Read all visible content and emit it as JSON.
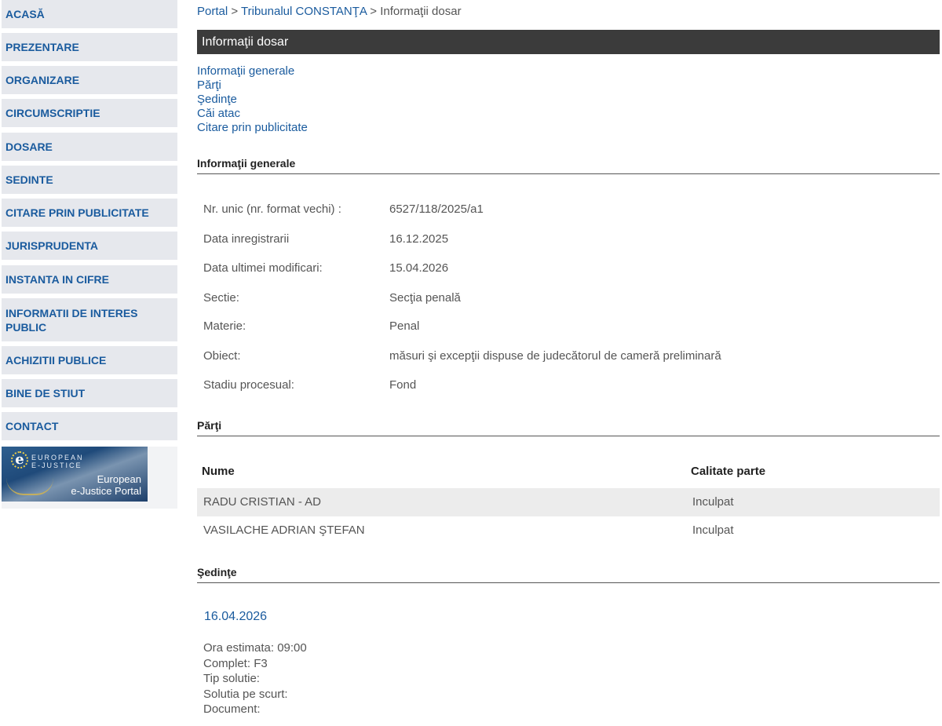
{
  "sidebar": {
    "items": [
      {
        "label": "ACASĂ"
      },
      {
        "label": "PREZENTARE"
      },
      {
        "label": "ORGANIZARE"
      },
      {
        "label": "CIRCUMSCRIPTIE"
      },
      {
        "label": "DOSARE"
      },
      {
        "label": "SEDINTE"
      },
      {
        "label": "CITARE PRIN PUBLICITATE"
      },
      {
        "label": "JURISPRUDENTA"
      },
      {
        "label": "INSTANTA IN CIFRE"
      },
      {
        "label": "INFORMATII DE INTERES PUBLIC"
      },
      {
        "label": "ACHIZITII PUBLICE"
      },
      {
        "label": "BINE DE STIUT"
      },
      {
        "label": "CONTACT"
      }
    ],
    "banner": {
      "small_text_1": "EUROPEAN",
      "small_text_2": "E-JUSTICE",
      "big_text_1": "European",
      "big_text_2": "e-Justice Portal"
    }
  },
  "breadcrumb": {
    "portal": "Portal",
    "sep": ">",
    "court": "Tribunalul CONSTANŢA",
    "current": "Informaţii dosar"
  },
  "page_title": "Informaţii dosar",
  "toc": [
    "Informaţii generale",
    "Părţi",
    "Şedinţe",
    "Căi atac",
    "Citare prin publicitate"
  ],
  "general": {
    "heading": "Informaţii generale",
    "rows": [
      {
        "label": "Nr. unic (nr. format vechi) :",
        "value": "6527/118/2025/a1"
      },
      {
        "label": "Data inregistrarii",
        "value": "16.12.2025"
      },
      {
        "label": "Data ultimei modificari:",
        "value": "15.04.2026"
      },
      {
        "label": "Sectie:",
        "value": "Secţia penală"
      },
      {
        "label": "Materie:",
        "value": "Penal"
      },
      {
        "label": "Obiect:",
        "value": "măsuri şi excepţii dispuse de judecătorul de cameră preliminară"
      },
      {
        "label": "Stadiu procesual:",
        "value": "Fond"
      }
    ]
  },
  "parti": {
    "heading": "Părţi",
    "col_name": "Nume",
    "col_role": "Calitate parte",
    "rows": [
      {
        "name": "RADU CRISTIAN - AD",
        "role": "Inculpat"
      },
      {
        "name": "VASILACHE ADRIAN ŞTEFAN",
        "role": "Inculpat"
      }
    ]
  },
  "sedinte": {
    "heading": "Şedinţe",
    "date": "16.04.2026",
    "details": [
      "Ora estimata: 09:00",
      "Complet: F3",
      "Tip solutie:",
      "Solutia pe scurt:",
      "Document:"
    ]
  }
}
